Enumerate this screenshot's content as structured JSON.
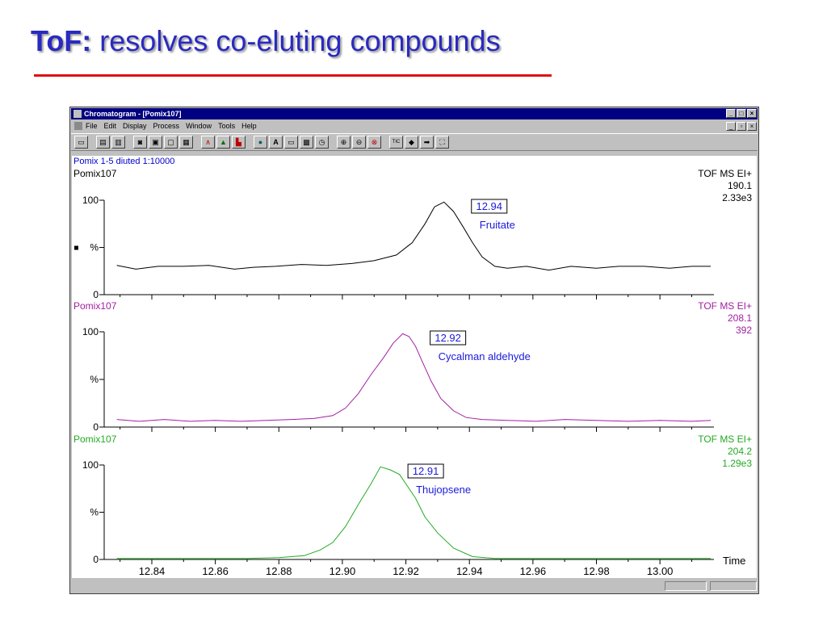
{
  "slide": {
    "title_bold": "ToF:",
    "title_rest": " resolves co-eluting compounds"
  },
  "window": {
    "title": "Chromatogram - [Pomix107]",
    "menu": [
      "File",
      "Edit",
      "Display",
      "Process",
      "Window",
      "Tools",
      "Help"
    ],
    "toolbar_icons": [
      "open-icon",
      "print-icon",
      "print-preview-icon",
      "camera-icon",
      "copy-icon",
      "paste-icon",
      "clipboard-icon",
      "peak-icon",
      "peaks-icon",
      "integrate-icon",
      "globe-icon",
      "text-icon",
      "window-icon",
      "windows-icon",
      "timer-icon",
      "zoom-in-icon",
      "zoom-out-icon",
      "zoom-reset-icon",
      "tic-icon",
      "arrow-left-icon",
      "arrow-right-icon",
      "fit-icon"
    ],
    "toolbar_text": {
      "text": "A",
      "tic": "TIC",
      "left": "◆",
      "right": "➡"
    }
  },
  "chart_data": {
    "type": "line",
    "header": "Pomix 1-5 diuted 1:10000",
    "xlabel": "Time",
    "xlim": [
      12.825,
      13.017
    ],
    "x_ticks": [
      "12.84",
      "12.86",
      "12.88",
      "12.90",
      "12.92",
      "12.94",
      "12.96",
      "12.98",
      "13.00"
    ],
    "y_ticks": [
      "100",
      "%",
      "0"
    ],
    "colors": {
      "header": "#0000cc",
      "annotation": "#1a1adb"
    },
    "panels": [
      {
        "sample": "Pomix107",
        "instrument": "TOF MS EI+",
        "mass": "190.1",
        "intensity": "2.33e3",
        "peak_time": "12.94",
        "compound": "Fruitate",
        "color": "#000000",
        "ylim": [
          0,
          100
        ],
        "x": [
          12.829,
          12.835,
          12.842,
          12.85,
          12.858,
          12.866,
          12.872,
          12.879,
          12.887,
          12.895,
          12.903,
          12.91,
          12.917,
          12.922,
          12.926,
          12.929,
          12.932,
          12.935,
          12.938,
          12.941,
          12.944,
          12.948,
          12.952,
          12.958,
          12.965,
          12.972,
          12.98,
          12.987,
          12.995,
          13.003,
          13.01,
          13.016
        ],
        "y": [
          31,
          27,
          30,
          30,
          31,
          27,
          29,
          30,
          32,
          31,
          33,
          36,
          42,
          55,
          75,
          93,
          98,
          88,
          72,
          55,
          40,
          30,
          28,
          30,
          26,
          30,
          28,
          30,
          30,
          28,
          30,
          30
        ]
      },
      {
        "sample": "Pomix107",
        "instrument": "TOF MS EI+",
        "mass": "208.1",
        "intensity": "392",
        "peak_time": "12.92",
        "compound": "Cycalman aldehyde",
        "color": "#a020a0",
        "ylim": [
          0,
          100
        ],
        "x": [
          12.829,
          12.836,
          12.844,
          12.852,
          12.86,
          12.868,
          12.876,
          12.884,
          12.891,
          12.897,
          12.901,
          12.905,
          12.909,
          12.913,
          12.916,
          12.919,
          12.921,
          12.923,
          12.925,
          12.928,
          12.931,
          12.935,
          12.939,
          12.944,
          12.952,
          12.961,
          12.97,
          12.98,
          12.99,
          13.0,
          13.01,
          13.016
        ],
        "y": [
          8,
          6,
          8,
          6,
          7,
          6,
          7,
          8,
          9,
          12,
          20,
          35,
          55,
          73,
          88,
          98,
          95,
          85,
          70,
          48,
          30,
          17,
          10,
          8,
          7,
          6,
          8,
          7,
          6,
          7,
          6,
          7
        ]
      },
      {
        "sample": "Pomix107",
        "instrument": "TOF MS EI+",
        "mass": "204.2",
        "intensity": "1.29e3",
        "peak_time": "12.91",
        "compound": "Thujopsene",
        "color": "#22aa22",
        "ylim": [
          0,
          100
        ],
        "x": [
          12.829,
          12.84,
          12.85,
          12.86,
          12.87,
          12.88,
          12.888,
          12.893,
          12.897,
          12.901,
          12.905,
          12.909,
          12.912,
          12.915,
          12.918,
          12.92,
          12.923,
          12.926,
          12.93,
          12.935,
          12.941,
          12.948,
          12.958,
          12.97,
          12.985,
          13.0,
          13.016
        ],
        "y": [
          1,
          1,
          1,
          1,
          1,
          2,
          4,
          10,
          18,
          35,
          58,
          80,
          98,
          95,
          90,
          80,
          65,
          45,
          28,
          12,
          3,
          1,
          1,
          1,
          1,
          1,
          1
        ]
      }
    ]
  }
}
